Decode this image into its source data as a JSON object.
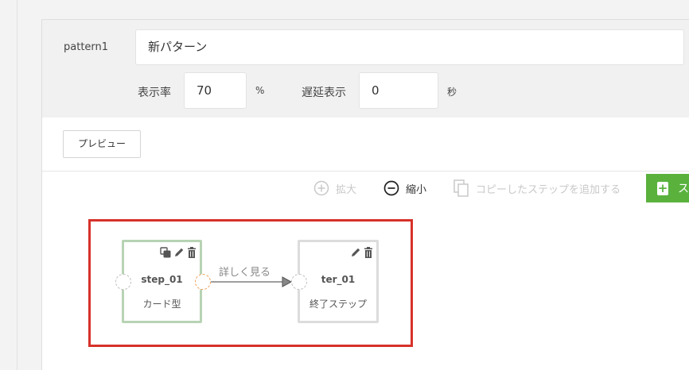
{
  "pattern": {
    "label": "pattern1",
    "name_value": "新パターン"
  },
  "settings": {
    "display_rate_label": "表示率",
    "display_rate_value": "70",
    "display_rate_unit": "%",
    "delay_label": "遅延表示",
    "delay_value": "0",
    "delay_unit": "秒"
  },
  "preview_button": "プレビュー",
  "toolbar": {
    "zoom_in": "拡大",
    "zoom_out": "縮小",
    "add_copied_step": "コピーしたステップを追加する",
    "add_step": "ス"
  },
  "flow": {
    "step_node": {
      "id": "step_01",
      "type": "カード型"
    },
    "edge_label": "詳しく見る",
    "terminal_node": {
      "id": "ter_01",
      "type": "終了ステップ"
    }
  },
  "colors": {
    "accent_green": "#5ab23d",
    "highlight_red": "#d7312a",
    "step_border": "#b7d3b4",
    "terminal_border": "#dcdcdc",
    "port_orange": "#f0a15a"
  }
}
